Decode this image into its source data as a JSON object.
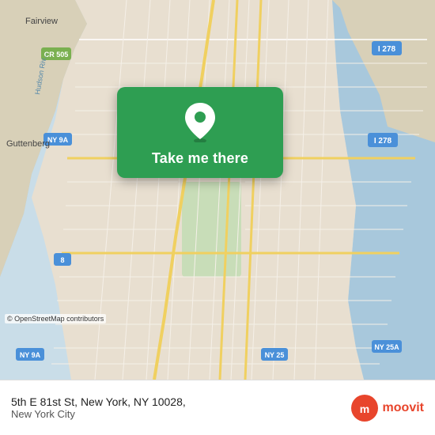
{
  "map": {
    "background_color": "#e8dfd0",
    "osm_credit": "© OpenStreetMap contributors"
  },
  "popup": {
    "button_label": "Take me there",
    "pin_icon": "location-pin"
  },
  "bottom_bar": {
    "address": "5th E 81st St, New York, NY 10028,",
    "city": "New York City",
    "logo_text": "moovit"
  },
  "labels": {
    "fairview": "Fairview",
    "guttenberg": "Guttenberg",
    "cr505": "CR 505",
    "ny9a_top": "NY 9A",
    "ny9a_bottom": "NY 9A",
    "ny8": "8",
    "i278_top": "I 278",
    "i278_bottom": "I 278",
    "ny25": "NY 25",
    "ny25a": "NY 25A"
  }
}
